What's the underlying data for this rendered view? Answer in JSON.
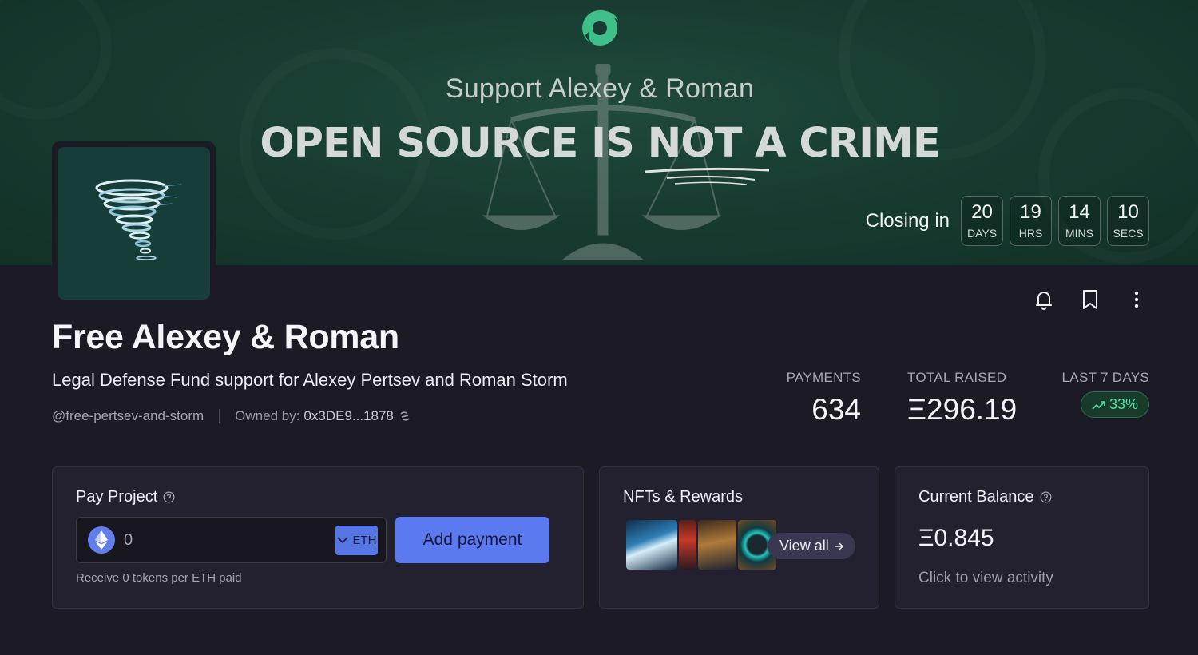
{
  "banner": {
    "subtitle": "Support Alexey & Roman",
    "headline": "OPEN SOURCE IS NOT A CRIME",
    "countdown": {
      "label": "Closing in",
      "units": [
        {
          "value": "20",
          "unit": "DAYS"
        },
        {
          "value": "19",
          "unit": "HRS"
        },
        {
          "value": "14",
          "unit": "MINS"
        },
        {
          "value": "10",
          "unit": "SECS"
        }
      ]
    }
  },
  "project": {
    "title": "Free Alexey & Roman",
    "description": "Legal Defense Fund support for Alexey Pertsev and Roman Storm",
    "handle": "@free-pertsev-and-storm",
    "owner_label": "Owned by:",
    "owner_address": "0x3DE9...1878"
  },
  "actions": {
    "icons": [
      "bell-icon",
      "bookmark-icon",
      "more-vertical-icon"
    ]
  },
  "stats": {
    "payments": {
      "label": "PAYMENTS",
      "value": "634"
    },
    "total_raised": {
      "label": "TOTAL RAISED",
      "value": "Ξ296.19"
    },
    "last_7_days": {
      "label": "LAST 7 DAYS",
      "value": "33%",
      "trend": "up"
    }
  },
  "pay_card": {
    "title": "Pay Project",
    "amount_value": "0",
    "currency": "ETH",
    "button_label": "Add payment",
    "note": "Receive 0 tokens per ETH paid"
  },
  "nft_card": {
    "title": "NFTs & Rewards",
    "view_all_label": "View all"
  },
  "balance_card": {
    "title": "Current Balance",
    "value": "Ξ0.845",
    "link": "Click to view activity"
  },
  "colors": {
    "page_bg": "#1c1a24",
    "banner_bg": "#183c31",
    "card_bg": "#232130",
    "accent_blue": "#5b7af0",
    "trend_green": "#4fe6a0",
    "brand_green": "#3fbf8a"
  }
}
